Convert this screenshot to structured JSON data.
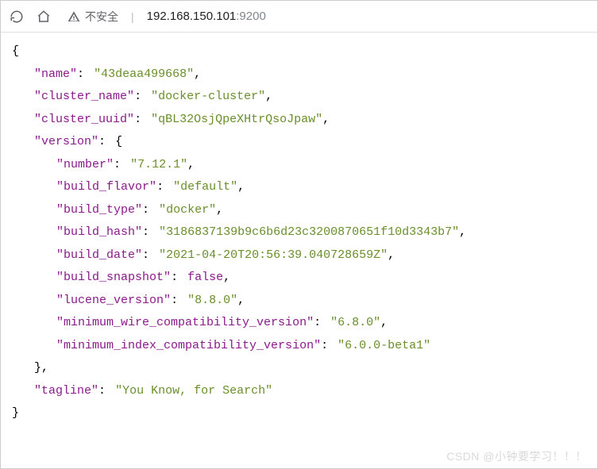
{
  "toolbar": {
    "security_label": "不安全",
    "url_host": "192.168.150.101",
    "url_port": ":9200"
  },
  "json": {
    "name_key": "name",
    "name_val": "43deaa499668",
    "cluster_name_key": "cluster_name",
    "cluster_name_val": "docker-cluster",
    "cluster_uuid_key": "cluster_uuid",
    "cluster_uuid_val": "qBL32OsjQpeXHtrQsoJpaw",
    "version_key": "version",
    "number_key": "number",
    "number_val": "7.12.1",
    "build_flavor_key": "build_flavor",
    "build_flavor_val": "default",
    "build_type_key": "build_type",
    "build_type_val": "docker",
    "build_hash_key": "build_hash",
    "build_hash_val": "3186837139b9c6b6d23c3200870651f10d3343b7",
    "build_date_key": "build_date",
    "build_date_val": "2021-04-20T20:56:39.040728659Z",
    "build_snapshot_key": "build_snapshot",
    "build_snapshot_val": "false",
    "lucene_version_key": "lucene_version",
    "lucene_version_val": "8.8.0",
    "min_wire_key": "minimum_wire_compatibility_version",
    "min_wire_val": "6.8.0",
    "min_index_key": "minimum_index_compatibility_version",
    "min_index_val": "6.0.0-beta1",
    "tagline_key": "tagline",
    "tagline_val": "You Know, for Search"
  },
  "watermark": "CSDN @小钟要学习！！！"
}
